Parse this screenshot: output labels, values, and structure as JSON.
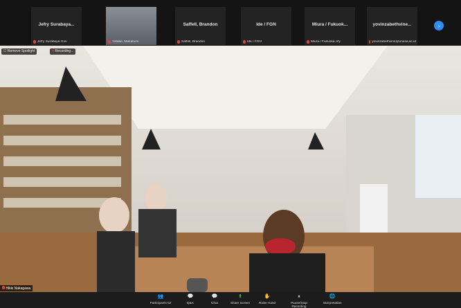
{
  "participants_strip": [
    {
      "name": "Jefry Surabaya...",
      "label": "Jefry Surabaya Gov"
    },
    {
      "name": "",
      "label": "Yatabe, Masafumi",
      "video": true
    },
    {
      "name": "Saffell, Brandon",
      "label": "Saffell, Brandon"
    },
    {
      "name": "Ide / FGN",
      "label": "Ide / FGN"
    },
    {
      "name": "Miura / Fukuok...",
      "label": "Miura / Fukuoka city"
    },
    {
      "name": "yovinzabethvine...",
      "label": "yovinzabethvine@unesa.ac.id"
    }
  ],
  "next_page_icon": "chevron-right-icon",
  "overlay": {
    "spotlight": "Remove Spotlight",
    "recording": "Recording..."
  },
  "speaker_label": "Hikki Nakagawa",
  "toolbar": [
    {
      "icon": "participants-icon",
      "glyph": "👥",
      "label": "Participants",
      "count": "52"
    },
    {
      "icon": "qa-icon",
      "glyph": "💬",
      "label": "Q&A"
    },
    {
      "icon": "chat-icon",
      "glyph": "💬",
      "label": "Chat"
    },
    {
      "icon": "share-screen-icon",
      "glyph": "⬆",
      "label": "Share Screen"
    },
    {
      "icon": "raise-hand-icon",
      "glyph": "✋",
      "label": "Raise Hand"
    },
    {
      "icon": "pause-recording-icon",
      "glyph": "⏸",
      "label": "Pause/Stop Recording"
    },
    {
      "icon": "interpretation-icon",
      "glyph": "🌐",
      "label": "Interpretation"
    }
  ]
}
